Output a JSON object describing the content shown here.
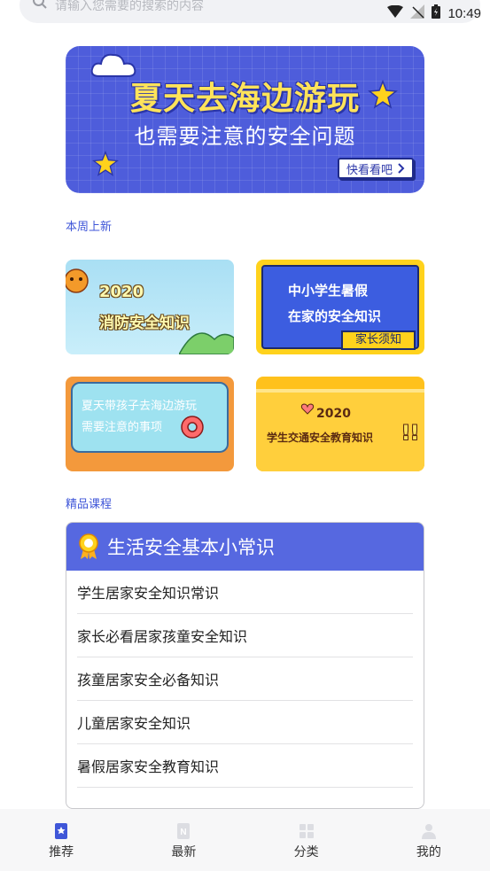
{
  "search": {
    "placeholder": "请输入您需要的搜索的内容"
  },
  "status": {
    "time": "10:49"
  },
  "hero": {
    "title": "夏天去海边游玩",
    "subtitle": "也需要注意的安全问题",
    "button_label": "快看看吧"
  },
  "weekly": {
    "label": "本周上新",
    "cards": [
      {
        "line1": "2020",
        "line2": "消防安全知识"
      },
      {
        "line1": "中小学生暑假",
        "line2": "在家的安全知识",
        "tag": "家长须知"
      },
      {
        "line1": "夏天带孩子去海边游玩",
        "line2": "需要注意的事项"
      },
      {
        "line1": "2020",
        "line2": "学生交通安全教育知识"
      }
    ]
  },
  "premium": {
    "label": "精品课程",
    "panel_title": "生活安全基本小常识",
    "items": [
      "学生居家安全知识常识",
      "家长必看居家孩童安全知识",
      "孩童居家安全必备知识",
      "儿童居家安全知识",
      "暑假居家安全教育知识"
    ]
  },
  "nav": {
    "items": [
      {
        "label": "推荐",
        "active": true
      },
      {
        "label": "最新",
        "active": false
      },
      {
        "label": "分类",
        "active": false
      },
      {
        "label": "我的",
        "active": false
      }
    ]
  },
  "colors": {
    "accent": "#4e5ddb",
    "panel_header": "#5668e0",
    "label_blue": "#3f56d8"
  }
}
